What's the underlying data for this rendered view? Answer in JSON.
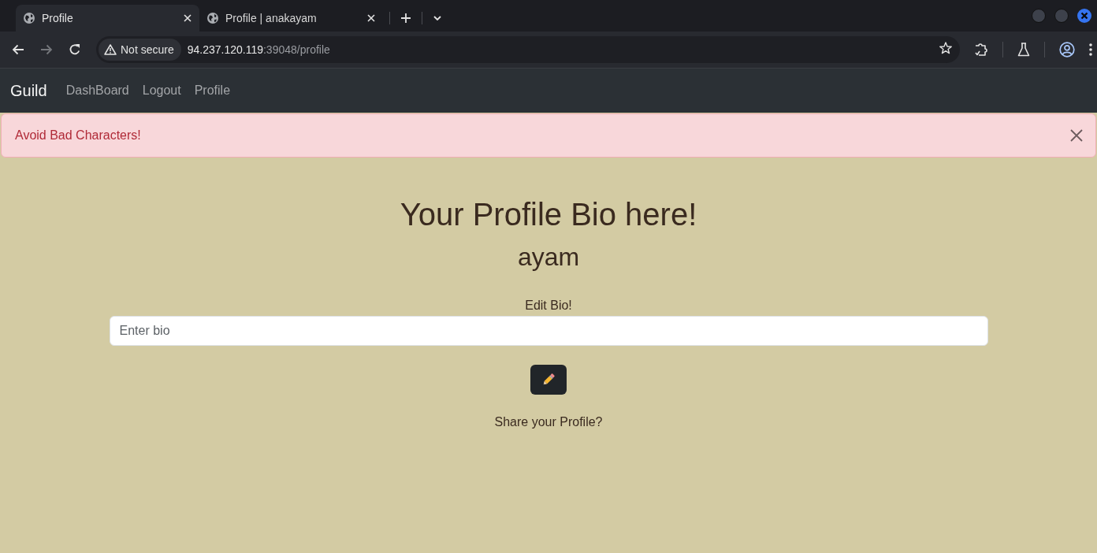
{
  "browser": {
    "tabs": [
      {
        "title": "Profile",
        "selected": true
      },
      {
        "title": "Profile | anakayam",
        "selected": false
      }
    ],
    "forward_button": {
      "disabled": true
    },
    "address": {
      "security_label": "Not secure",
      "host": "94.237.120.119",
      "path": ":39048/profile"
    }
  },
  "navbar": {
    "brand": "Guild",
    "links": [
      "DashBoard",
      "Logout",
      "Profile"
    ]
  },
  "alert": {
    "message": "Avoid Bad Characters!"
  },
  "profile": {
    "heading": "Your Profile Bio here!",
    "username": "ayam",
    "bio_label": "Edit Bio!",
    "bio_field": {
      "placeholder": "Enter bio"
    },
    "share_text": "Share your Profile?"
  }
}
